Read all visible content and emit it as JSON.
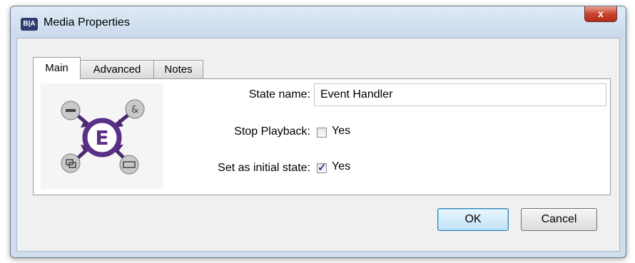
{
  "window": {
    "title": "Media Properties",
    "app_icon_text": "B|A",
    "close_symbol": "x"
  },
  "tabs": [
    {
      "label": "Main",
      "active": true
    },
    {
      "label": "Advanced",
      "active": false
    },
    {
      "label": "Notes",
      "active": false
    }
  ],
  "main": {
    "state_name_label": "State name:",
    "state_name_value": "Event Handler",
    "stop_playback_label": "Stop Playback:",
    "stop_playback_text": "Yes",
    "stop_playback_checked": false,
    "initial_state_label": "Set as initial state:",
    "initial_state_text": "Yes",
    "initial_state_checked": true,
    "graphic_letter": "E",
    "graphic_icon": "event-handler-icon"
  },
  "buttons": {
    "ok_label": "OK",
    "cancel_label": "Cancel"
  },
  "colors": {
    "graphic_accent": "#5a2f86",
    "title_bar": "#cfdded"
  }
}
